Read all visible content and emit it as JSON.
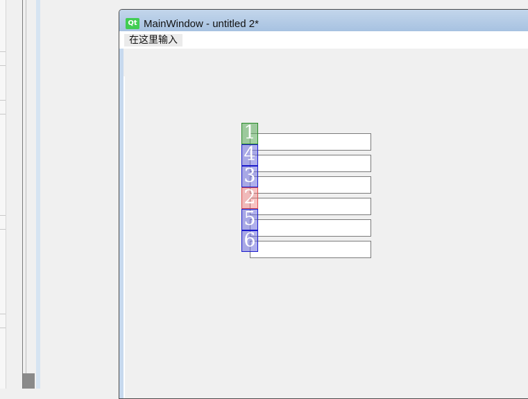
{
  "window": {
    "title": "MainWindow - untitled 2*",
    "icon": "qt-logo-icon",
    "icon_text": "Qt"
  },
  "menubar": {
    "placeholder_item": "在这里输入"
  },
  "form": {
    "fields": [
      {
        "id": 1,
        "value": ""
      },
      {
        "id": 2,
        "value": ""
      },
      {
        "id": 3,
        "value": ""
      },
      {
        "id": 4,
        "value": ""
      },
      {
        "id": 5,
        "value": ""
      },
      {
        "id": 6,
        "value": ""
      }
    ],
    "tab_order_markers": [
      {
        "label": "1",
        "color": "#5aaa5a"
      },
      {
        "label": "4",
        "color": "#6e6edc"
      },
      {
        "label": "3",
        "color": "#6e6edc"
      },
      {
        "label": "2",
        "color": "#f07878"
      },
      {
        "label": "5",
        "color": "#6e6edc"
      },
      {
        "label": "6",
        "color": "#6e6edc"
      }
    ]
  }
}
